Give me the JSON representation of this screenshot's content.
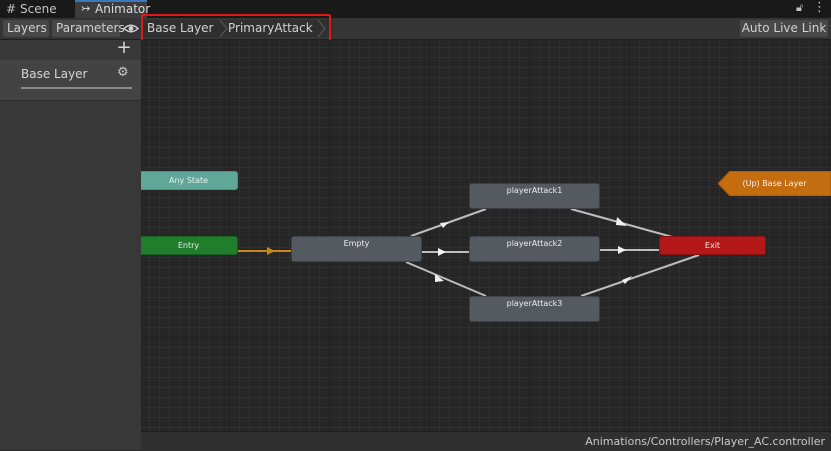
{
  "tabs": [
    {
      "label": "Scene",
      "icon": "grid-hash-icon",
      "active": false
    },
    {
      "label": "Animator",
      "icon": "animator-icon",
      "active": true
    }
  ],
  "window_icons": [
    "lock-icon",
    "kebab-menu-icon"
  ],
  "toolbar": {
    "layers_label": "Layers",
    "parameters_label": "Parameters",
    "eye_icon": "eye-icon",
    "breadcrumb": [
      "Base Layer",
      "PrimaryAttack"
    ],
    "auto_live_link_label": "Auto Live Link"
  },
  "left_panel": {
    "add_icon": "plus-icon",
    "layers": [
      {
        "name": "Base Layer",
        "settings_icon": "gear-icon"
      }
    ]
  },
  "graph": {
    "nodes": {
      "any_state": "Any State",
      "entry": "Entry",
      "empty": "Empty",
      "player_attack_1": "playerAttack1",
      "player_attack_2": "playerAttack2",
      "player_attack_3": "playerAttack3",
      "exit": "Exit",
      "up_base_layer": "(Up) Base Layer"
    },
    "transitions": [
      {
        "from": "Entry",
        "to": "Empty",
        "default": true
      },
      {
        "from": "Empty",
        "to": "playerAttack1"
      },
      {
        "from": "Empty",
        "to": "playerAttack2"
      },
      {
        "from": "Empty",
        "to": "playerAttack3"
      },
      {
        "from": "playerAttack1",
        "to": "Exit"
      },
      {
        "from": "playerAttack2",
        "to": "Exit"
      },
      {
        "from": "playerAttack3",
        "to": "Exit"
      }
    ],
    "colors": {
      "any_state": "#5fa897",
      "entry": "#1f7d2c",
      "state": "#555a60",
      "exit": "#b21818",
      "up_base_layer": "#c36d10",
      "default_transition": "#c8861a",
      "transition": "#bdbdbd",
      "highlight": "#e01818"
    }
  },
  "status_bar": {
    "path": "Animations/Controllers/Player_AC.controller"
  }
}
